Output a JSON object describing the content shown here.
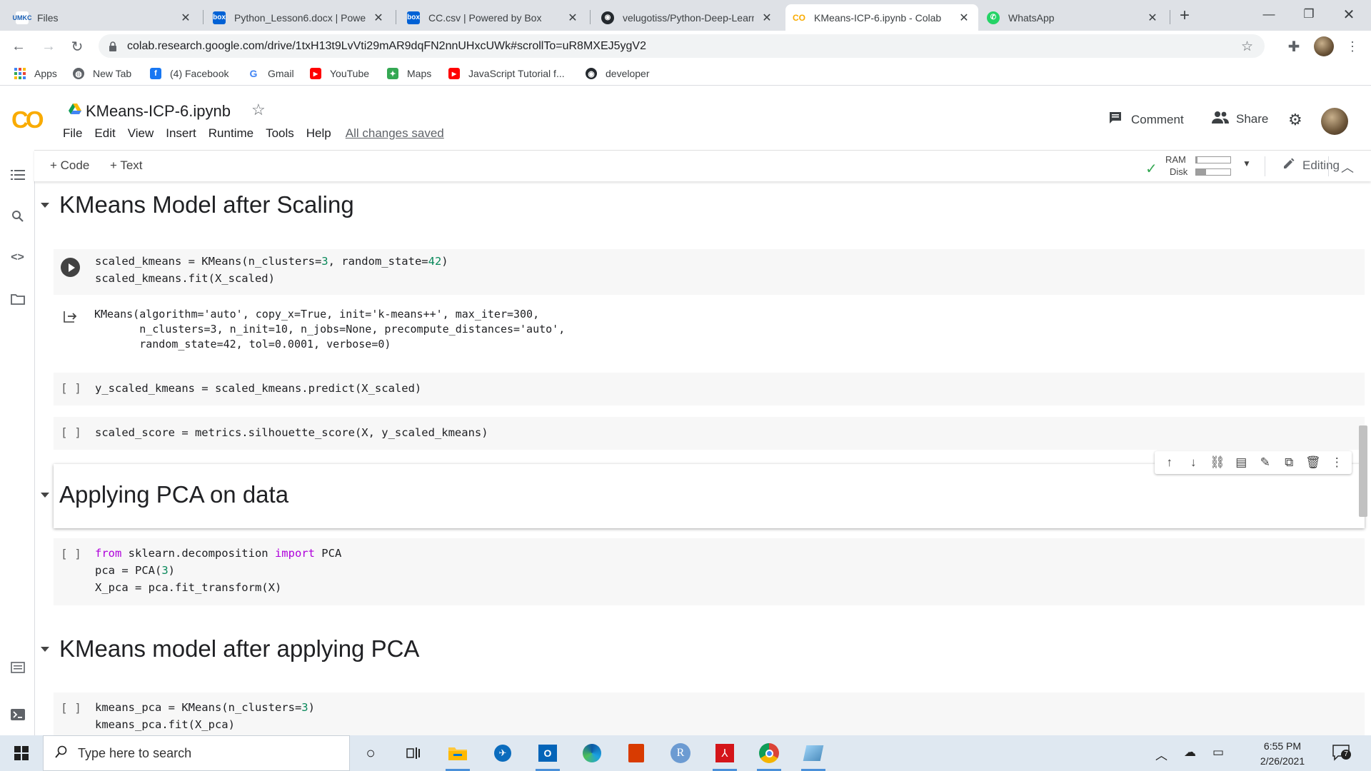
{
  "browser": {
    "tabs": [
      {
        "label": "Files",
        "icon": "umkc-icon"
      },
      {
        "label": "Python_Lesson6.docx | Powered by Box",
        "icon": "box-icon"
      },
      {
        "label": "CC.csv | Powered by Box",
        "icon": "box-icon"
      },
      {
        "label": "velugotiss/Python-Deep-Learning",
        "icon": "github-icon"
      },
      {
        "label": "KMeans-ICP-6.ipynb - Colab",
        "icon": "colab-icon",
        "active": true
      },
      {
        "label": "WhatsApp",
        "icon": "whatsapp-icon"
      }
    ],
    "new_tab": "+",
    "url": "colab.research.google.com/drive/1txH13t9LvVti29mAR9dqFN2nnUHxcUWk#scrollTo=uR8MXEJ5ygV2",
    "bookmarks": [
      {
        "label": "Apps",
        "icon": "apps-grid-icon"
      },
      {
        "label": "New Tab",
        "icon": "globe-icon"
      },
      {
        "label": "(4) Facebook",
        "icon": "facebook-icon"
      },
      {
        "label": "Gmail",
        "icon": "google-icon"
      },
      {
        "label": "YouTube",
        "icon": "youtube-icon"
      },
      {
        "label": "Maps",
        "icon": "maps-icon"
      },
      {
        "label": "JavaScript Tutorial f...",
        "icon": "youtube-icon"
      },
      {
        "label": "developer",
        "icon": "github-icon"
      }
    ]
  },
  "colab": {
    "logo": "CO",
    "notebook_name": "KMeans-ICP-6.ipynb",
    "menu": [
      "File",
      "Edit",
      "View",
      "Insert",
      "Runtime",
      "Tools",
      "Help"
    ],
    "save_status": "All changes saved",
    "comment_label": "Comment",
    "share_label": "Share",
    "toolbar": {
      "add_code": "+ Code",
      "add_text": "+ Text",
      "ram_label": "RAM",
      "disk_label": "Disk",
      "ram_fraction": 0.05,
      "disk_fraction": 0.3,
      "editing_label": "Editing"
    }
  },
  "notebook": {
    "sections": {
      "s1": "KMeans Model after Scaling",
      "s2": "Applying PCA on data",
      "s3": "KMeans model after applying PCA"
    },
    "cells": {
      "c1_line1_a": "scaled_kmeans = KMeans(n_clusters=",
      "c1_line1_n1": "3",
      "c1_line1_b": ", random_state=",
      "c1_line1_n2": "42",
      "c1_line1_c": ")",
      "c1_line2": "scaled_kmeans.fit(X_scaled)",
      "c1_output": "KMeans(algorithm='auto', copy_x=True, init='k-means++', max_iter=300,\n       n_clusters=3, n_init=10, n_jobs=None, precompute_distances='auto',\n       random_state=42, tol=0.0001, verbose=0)",
      "c2_prompt": "[ ]",
      "c2_code": "y_scaled_kmeans = scaled_kmeans.predict(X_scaled)",
      "c3_prompt": "[ ]",
      "c3_code": "scaled_score = metrics.silhouette_score(X, y_scaled_kmeans)",
      "c4_prompt": "[ ]",
      "c4_kw1": "from",
      "c4_mod": " sklearn.decomposition ",
      "c4_kw2": "import",
      "c4_name": " PCA",
      "c4_line2_a": "pca = PCA(",
      "c4_line2_n": "3",
      "c4_line2_b": ")",
      "c4_line3": "X_pca = pca.fit_transform(X)",
      "c5_prompt": "[ ]",
      "c5_line1_a": "kmeans_pca = KMeans(n_clusters=",
      "c5_line1_n": "3",
      "c5_line1_b": ")",
      "c5_line2": "kmeans_pca.fit(X_pca)"
    }
  },
  "taskbar": {
    "search_placeholder": "Type here to search",
    "time": "6:55 PM",
    "date": "2/26/2021",
    "notification_count": "7"
  }
}
